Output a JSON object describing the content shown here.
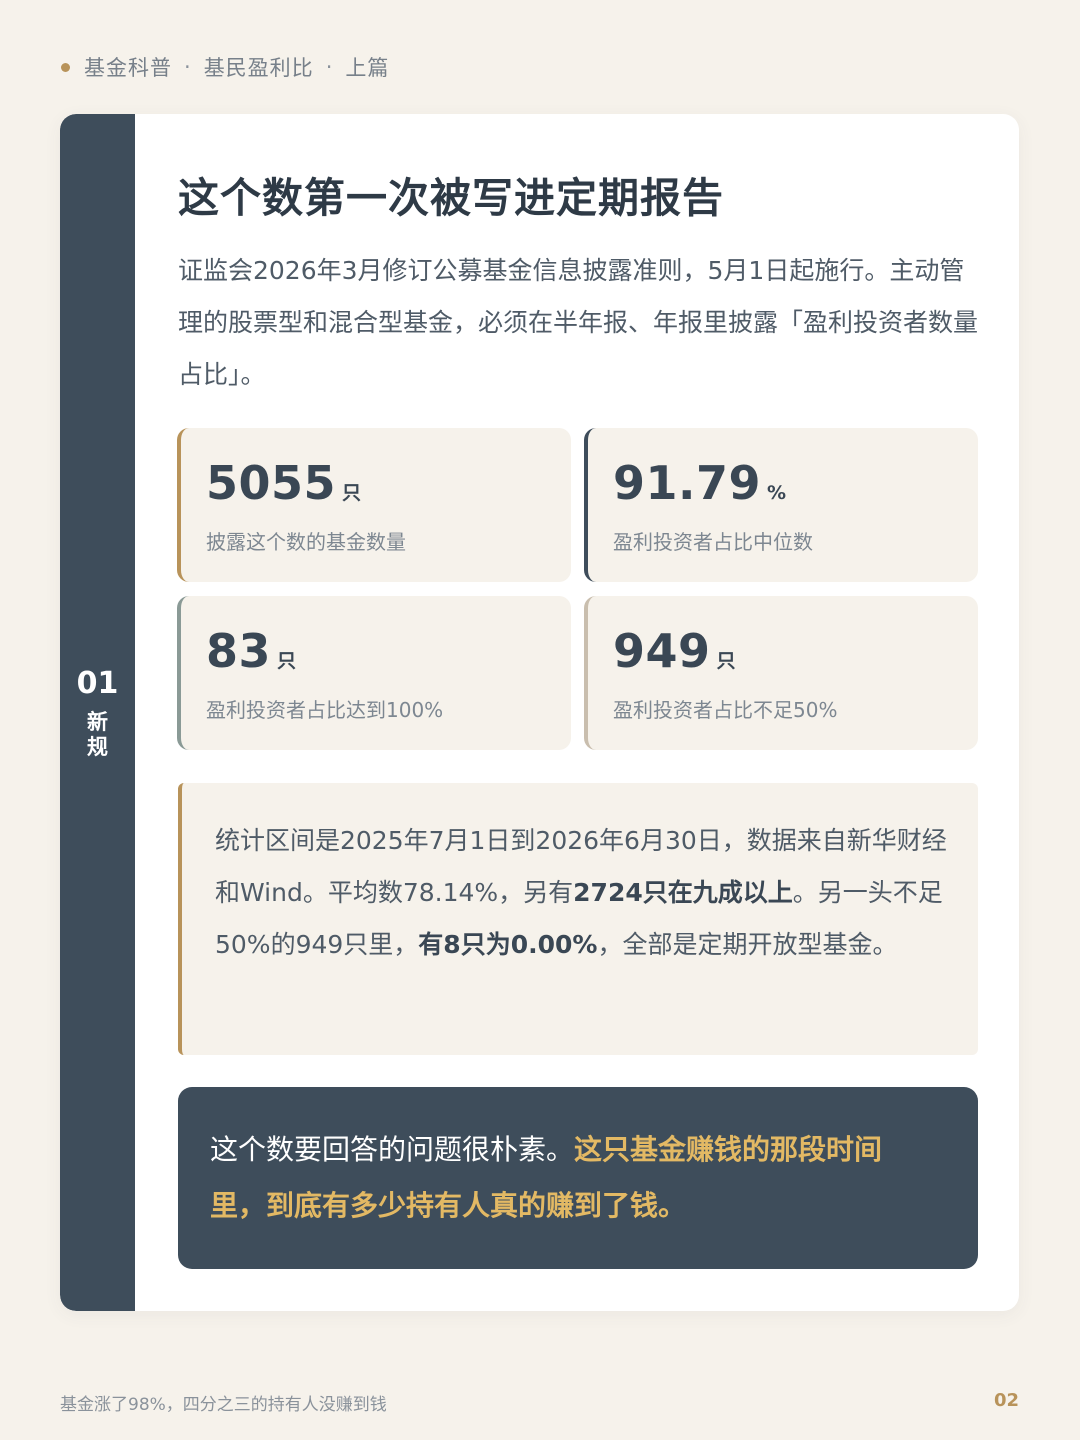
{
  "breadcrumb": {
    "items": [
      "基金科普",
      "基民盈利比",
      "上篇"
    ],
    "separator": "·"
  },
  "section": {
    "number": "01",
    "label_chars": [
      "新",
      "规"
    ]
  },
  "main": {
    "title": "这个数第一次被写进定期报告",
    "intro": "证监会2026年3月修订公募基金信息披露准则，5月1日起施行。主动管理的股票型和混合型基金，必须在半年报、年报里披露「盈利投资者数量占比」。"
  },
  "stats": [
    {
      "value": "5055",
      "unit": "只",
      "label": "披露这个数的基金数量",
      "accent": "#b8935a"
    },
    {
      "value": "91.79",
      "unit": "%",
      "label": "盈利投资者占比中位数",
      "accent": "#3e4d5b"
    },
    {
      "value": "83",
      "unit": "只",
      "label": "盈利投资者占比达到100%",
      "accent": "#8a9a96"
    },
    {
      "value": "949",
      "unit": "只",
      "label": "盈利投资者占比不足50%",
      "accent": "#c9beae"
    }
  ],
  "note": {
    "part1": "统计区间是2025年7月1日到2026年6月30日，数据来自新华财经和Wind。平均数78.14%，另有",
    "bold1": "2724只在九成以上",
    "part2": "。另一头不足50%的949只里，",
    "bold2": "有8只为0.00%",
    "part3": "，全部是定期开放型基金。"
  },
  "callout": {
    "plain": "这个数要回答的问题很朴素。",
    "highlight": "这只基金赚钱的那段时间里，到底有多少持有人真的赚到了钱。"
  },
  "footer": {
    "left": "基金涨了98%，四分之三的持有人没赚到钱",
    "page": "02"
  },
  "colors": {
    "background": "#f6f2eb",
    "navy": "#3e4d5b",
    "gold": "#b8935a",
    "highlight": "#e3b964"
  }
}
